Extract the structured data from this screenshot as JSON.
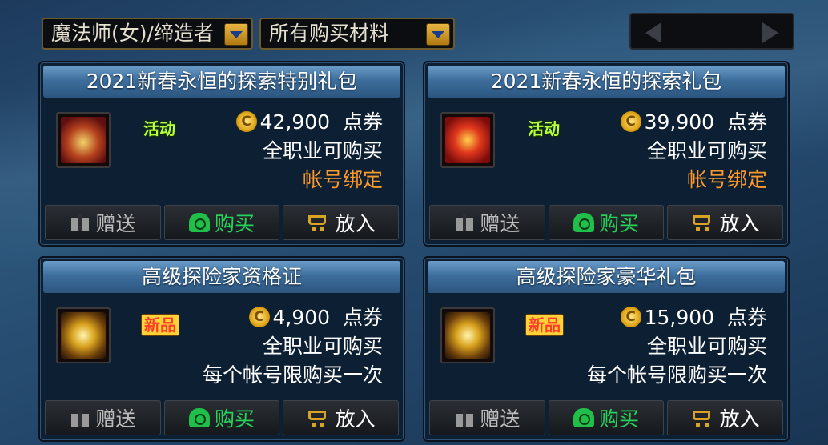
{
  "filters": {
    "class_select": "魔法师(女)/缔造者",
    "category_select": "所有购买材料"
  },
  "items": [
    {
      "title": "2021新春永恒的探索特别礼包",
      "icon": "gold-treasure-chest-icon",
      "tag": "活动",
      "price": "42,900",
      "currency": "点券",
      "line2": "全职业可购买",
      "line3": "帐号绑定",
      "line3_color": "#ff9a2a"
    },
    {
      "title": "2021新春永恒的探索礼包",
      "icon": "red-treasure-chest-icon",
      "tag": "活动",
      "price": "39,900",
      "currency": "点券",
      "line2": "全职业可购买",
      "line3": "帐号绑定",
      "line3_color": "#ff9a2a"
    },
    {
      "title": "高级探险家资格证",
      "icon": "golden-orb-icon",
      "tag": "新品",
      "price": "4,900",
      "currency": "点券",
      "line2": "全职业可购买",
      "line3": "每个帐号限购买一次",
      "line3_color": "#ffffff"
    },
    {
      "title": "高级探险家豪华礼包",
      "icon": "golden-orb-icon",
      "tag": "新品",
      "price": "15,900",
      "currency": "点券",
      "line2": "全职业可购买",
      "line3": "每个帐号限购买一次",
      "line3_color": "#ffffff"
    }
  ],
  "buttons": {
    "gift": "赠送",
    "buy": "购买",
    "cart": "放入"
  },
  "colors": {
    "accent_green": "#26d35a",
    "bind_orange": "#ff9a2a",
    "title_bar_blue": "#3e6e9c"
  }
}
